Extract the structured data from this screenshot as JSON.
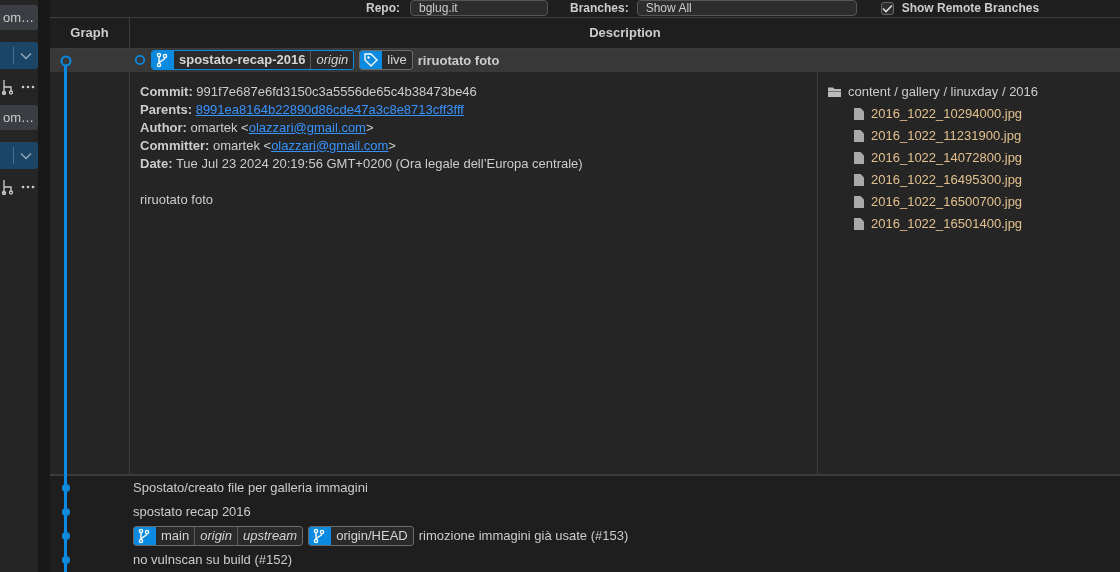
{
  "toolbar": {
    "repo": {
      "label": "Repo:",
      "value": "bglug.it"
    },
    "branches": {
      "label": "Branches:",
      "value": "Show All"
    },
    "show_remote": {
      "label": "Show Remote Branches",
      "checked": true
    }
  },
  "sidebar": {
    "groups": [
      {
        "button": "om…"
      },
      {
        "button": "om…"
      }
    ]
  },
  "table": {
    "columns": [
      "Graph",
      "Description"
    ]
  },
  "selected_commit": {
    "refs": [
      {
        "kind": "branch",
        "name": "spostato-recap-2016",
        "remotes": [
          "origin"
        ]
      },
      {
        "kind": "tag",
        "name": "live"
      }
    ],
    "message": "riruotato foto",
    "details": [
      {
        "label": "Commit:",
        "text": "991f7e687e6fd3150c3a5556de65c4b38473be46"
      },
      {
        "label": "Parents:",
        "link": "8991ea8164b22890d86cde47a3c8e8713cff3fff"
      },
      {
        "label": "Author:",
        "text": "omartek <",
        "link": "olazzari@gmail.com",
        "suffix": ">"
      },
      {
        "label": "Committer:",
        "text": "omartek <",
        "link": "olazzari@gmail.com",
        "suffix": ">"
      },
      {
        "label": "Date:",
        "text": "Tue Jul 23 2024 20:19:56 GMT+0200 (Ora legale dell’Europa centrale)"
      }
    ],
    "body": "riruotato foto",
    "files": {
      "folder": "content / gallery / linuxday / 2016",
      "items": [
        "2016_1022_10294000.jpg",
        "2016_1022_11231900.jpg",
        "2016_1022_14072800.jpg",
        "2016_1022_16495300.jpg",
        "2016_1022_16500700.jpg",
        "2016_1022_16501400.jpg"
      ]
    }
  },
  "commits": [
    {
      "message": "Spostato/creato file per galleria immagini"
    },
    {
      "message": "spostato recap 2016"
    },
    {
      "message": "rimozione immagini già usate (#153)",
      "refs": [
        {
          "kind": "branch",
          "name": "main",
          "remotes": [
            "origin",
            "upstream"
          ]
        },
        {
          "kind": "branch",
          "name": "origin/HEAD"
        }
      ]
    },
    {
      "message": "no vulnscan su build (#152)"
    }
  ]
}
